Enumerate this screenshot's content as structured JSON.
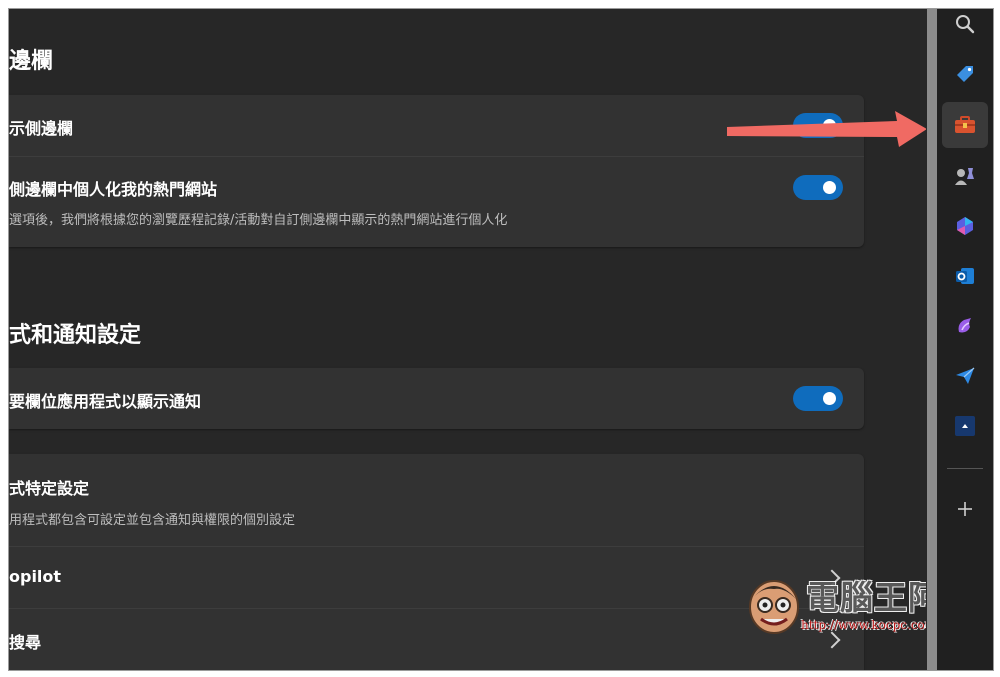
{
  "sections": {
    "sidebar_title": "邊欄",
    "apps_title": "式和通知設定"
  },
  "settings": {
    "show_sidebar_label": "示側邊欄",
    "personalize_label": "側邊欄中個人化我的熱門網站",
    "personalize_desc": "選項後，我們將根據您的瀏覽歷程記錄/活動對自訂側邊欄中顯示的熱門網站進行個人化",
    "notify_label": "要欄位應用程式以顯示通知",
    "app_specific_label": "式特定設定",
    "app_specific_desc": "用程式都包含可設定並包含通知與權限的個別設定",
    "copilot_label": "opilot",
    "search_label": "搜尋"
  },
  "toggles": {
    "show_sidebar": "on",
    "personalize": "on",
    "notify": "on"
  },
  "sidebar_icons": [
    "search-icon",
    "tag-icon",
    "toolbox-icon",
    "games-icon",
    "copilot-icon",
    "outlook-icon",
    "designer-icon",
    "send-icon",
    "app-icon",
    "add-icon"
  ],
  "colors": {
    "accent": "#0f6cbd",
    "arrow": "#f06a63",
    "background": "#272727",
    "card": "#323232"
  },
  "watermark": {
    "text": "電腦王阿達",
    "url": "http://www.kocpc.com.tw"
  }
}
